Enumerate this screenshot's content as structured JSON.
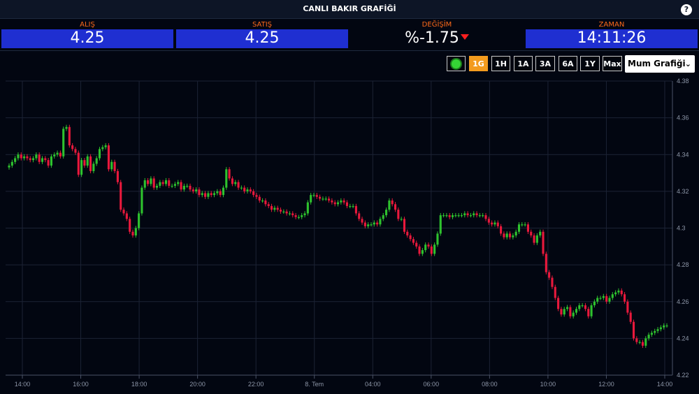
{
  "header": {
    "title": "CANLI BAKIR GRAFİĞİ",
    "help": "?"
  },
  "stats": [
    {
      "label": "ALIŞ",
      "value": "4.25"
    },
    {
      "label": "SATIŞ",
      "value": "4.25"
    },
    {
      "label": "DEĞİŞİM",
      "value": "%-1.75"
    },
    {
      "label": "ZAMAN",
      "value": "14:11:26"
    }
  ],
  "toolbar": {
    "ranges": [
      "1G",
      "1H",
      "1A",
      "3A",
      "6A",
      "1Y",
      "Max"
    ],
    "active_range": "1G",
    "chart_type": "Mum Grafiği"
  },
  "colors": {
    "up": "#2ec22e",
    "down": "#e8193c",
    "accent": "#f39b1e",
    "stat_bg": "#1f2fd1",
    "label": "#ff6a1a"
  },
  "chart_data": {
    "type": "candlestick",
    "xticks": [
      "14:00",
      "16:00",
      "18:00",
      "20:00",
      "22:00",
      "8. Tem",
      "04:00",
      "06:00",
      "08:00",
      "10:00",
      "12:00",
      "14:00"
    ],
    "ylim": [
      4.22,
      4.38
    ],
    "yticks": [
      "4.38",
      "4.36",
      "4.34",
      "4.32",
      "4.3",
      "4.28",
      "4.26",
      "4.24",
      "4.22"
    ],
    "close": [
      4.334,
      4.336,
      4.338,
      4.34,
      4.338,
      4.339,
      4.338,
      4.337,
      4.338,
      4.34,
      4.336,
      4.338,
      4.337,
      4.334,
      4.339,
      4.34,
      4.341,
      4.339,
      4.354,
      4.355,
      4.345,
      4.343,
      4.341,
      4.329,
      4.337,
      4.334,
      4.339,
      4.331,
      4.335,
      4.338,
      4.343,
      4.344,
      4.345,
      4.332,
      4.336,
      4.331,
      4.325,
      4.31,
      4.308,
      4.305,
      4.298,
      4.296,
      4.3,
      4.308,
      4.322,
      4.326,
      4.324,
      4.327,
      4.322,
      4.323,
      4.325,
      4.324,
      4.326,
      4.323,
      4.323,
      4.324,
      4.325,
      4.321,
      4.323,
      4.323,
      4.321,
      4.32,
      4.321,
      4.318,
      4.319,
      4.317,
      4.319,
      4.318,
      4.319,
      4.32,
      4.318,
      4.322,
      4.332,
      4.327,
      4.324,
      4.325,
      4.322,
      4.322,
      4.32,
      4.321,
      4.32,
      4.318,
      4.317,
      4.315,
      4.315,
      4.313,
      4.312,
      4.31,
      4.311,
      4.31,
      4.309,
      4.309,
      4.308,
      4.308,
      4.307,
      4.306,
      4.306,
      4.307,
      4.308,
      4.314,
      4.318,
      4.318,
      4.317,
      4.316,
      4.316,
      4.316,
      4.315,
      4.314,
      4.313,
      4.314,
      4.315,
      4.314,
      4.312,
      4.312,
      4.312,
      4.308,
      4.305,
      4.303,
      4.301,
      4.302,
      4.302,
      4.303,
      4.302,
      4.305,
      4.307,
      4.31,
      4.315,
      4.313,
      4.31,
      4.305,
      4.305,
      4.298,
      4.296,
      4.294,
      4.292,
      4.29,
      4.286,
      4.288,
      4.291,
      4.29,
      4.286,
      4.291,
      4.297,
      4.307,
      4.307,
      4.307,
      4.306,
      4.307,
      4.307,
      4.307,
      4.307,
      4.308,
      4.307,
      4.307,
      4.308,
      4.307,
      4.307,
      4.307,
      4.305,
      4.303,
      4.302,
      4.303,
      4.301,
      4.297,
      4.295,
      4.297,
      4.295,
      4.296,
      4.298,
      4.302,
      4.302,
      4.302,
      4.298,
      4.296,
      4.292,
      4.296,
      4.298,
      4.286,
      4.276,
      4.273,
      4.268,
      4.262,
      4.256,
      4.253,
      4.256,
      4.257,
      4.252,
      4.254,
      4.256,
      4.258,
      4.258,
      4.256,
      4.252,
      4.258,
      4.26,
      4.262,
      4.262,
      4.263,
      4.26,
      4.262,
      4.264,
      4.265,
      4.266,
      4.264,
      4.26,
      4.254,
      4.249,
      4.24,
      4.238,
      4.238,
      4.236,
      4.24,
      4.242,
      4.243,
      4.244,
      4.245,
      4.246,
      4.247,
      4.247
    ]
  }
}
